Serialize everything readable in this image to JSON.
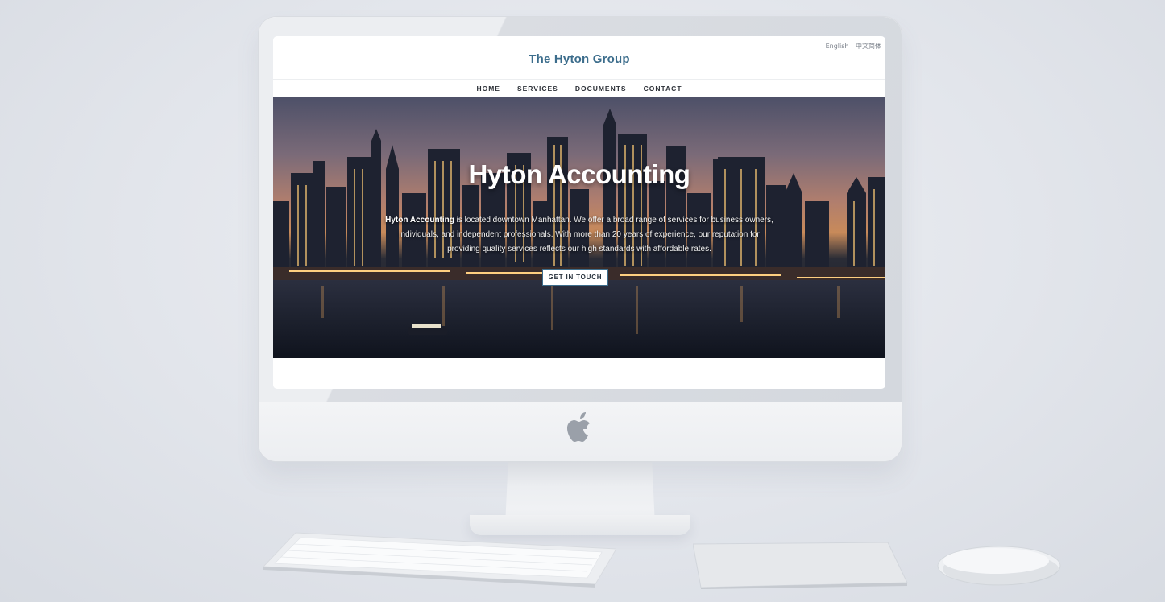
{
  "site": {
    "title": "The Hyton Group",
    "languages": [
      "English",
      "中文简体"
    ]
  },
  "nav": {
    "items": [
      {
        "label": "HOME",
        "active": true
      },
      {
        "label": "SERVICES",
        "active": false
      },
      {
        "label": "DOCUMENTS",
        "active": false
      },
      {
        "label": "CONTACT",
        "active": false
      }
    ]
  },
  "hero": {
    "title": "Hyton Accounting",
    "intro_bold": "Hyton Accounting",
    "intro_rest": " is located downtown Manhattan. We offer a broad range of services for business owners, individuals, and independent professionals. With more than 20 years of experience, our reputation for providing quality services reflects our high standards with affordable rates.",
    "cta_label": "GET IN TOUCH"
  },
  "colors": {
    "accent": "#3c6d8c",
    "background": "#e2e5eb"
  },
  "icons": [
    "apple-logo-icon"
  ]
}
